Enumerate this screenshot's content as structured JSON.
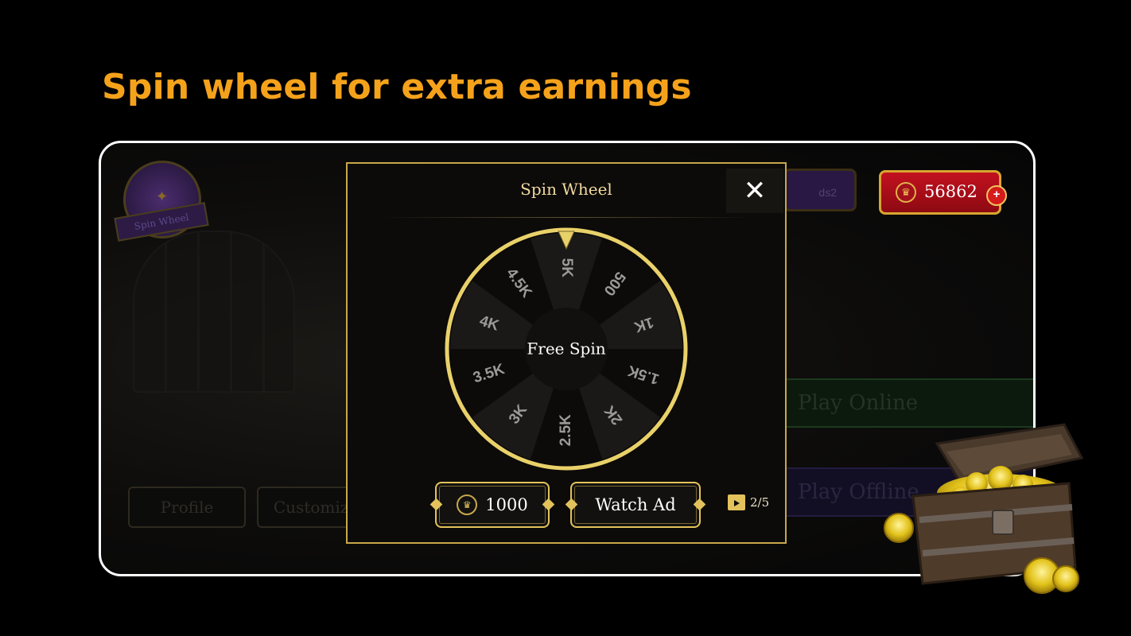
{
  "headline": "Spin wheel for extra earnings",
  "background": {
    "badge_label": "Spin Wheel",
    "pill_text": "ds2",
    "coins": "56862",
    "bottom_buttons": [
      "Profile",
      "Customize"
    ],
    "play_buttons": [
      "Play Online",
      "Play Offline"
    ]
  },
  "modal": {
    "title": "Spin Wheel",
    "close_icon": "close-icon",
    "center_label": "Free Spin",
    "wheel_segments": [
      "5K",
      "500",
      "1K",
      "1.5K",
      "2K",
      "2.5K",
      "3K",
      "3.5K",
      "4K",
      "4.5K"
    ],
    "spin_cost": "1000",
    "watch_ad_label": "Watch Ad",
    "ad_count": "2/5"
  },
  "colors": {
    "accent_orange": "#f5a21b",
    "gold": "#e3c25c",
    "coin_red": "#c3111f"
  }
}
